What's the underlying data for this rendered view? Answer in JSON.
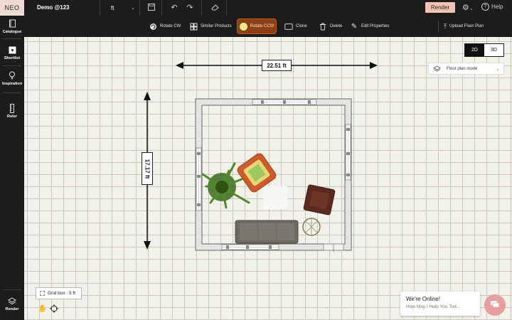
{
  "app": {
    "logo": "NEO",
    "project_name": "Demo @123",
    "unit": "ft"
  },
  "header": {
    "render_label": "Render",
    "help_label": "Help"
  },
  "toolbar": {
    "rotate_cw": "Rotate CW",
    "similar_products": "Similar Products",
    "rotate_ccw": "Rotate CCW",
    "clone": "Clone",
    "delete": "Delete",
    "edit_properties": "Edit Properties",
    "upload_floor_plan": "Upload Floor Plan"
  },
  "sidebar": {
    "items": [
      {
        "label": "Catalogue",
        "icon": "catalogue-icon"
      },
      {
        "label": "Shortlist",
        "icon": "heart-icon"
      },
      {
        "label": "Inspiration",
        "icon": "bulb-icon"
      },
      {
        "label": "Ruler",
        "icon": "ruler-icon"
      }
    ],
    "render_label": "Render"
  },
  "canvas": {
    "view_2d": "2D",
    "view_3d": "3D",
    "active_view": "2D",
    "plan_mode": "Floor plan mode",
    "width_dim": "22.51 ft",
    "height_dim": "17.17 ft",
    "grid_box": "Grid box : 5 ft"
  },
  "chat": {
    "title": "We're Online!",
    "subtitle": "How May I Help You Tod..."
  },
  "colors": {
    "accent": "#f2c3b4",
    "active_tool": "#8f3f14",
    "chat_button": "#e79e9c"
  }
}
